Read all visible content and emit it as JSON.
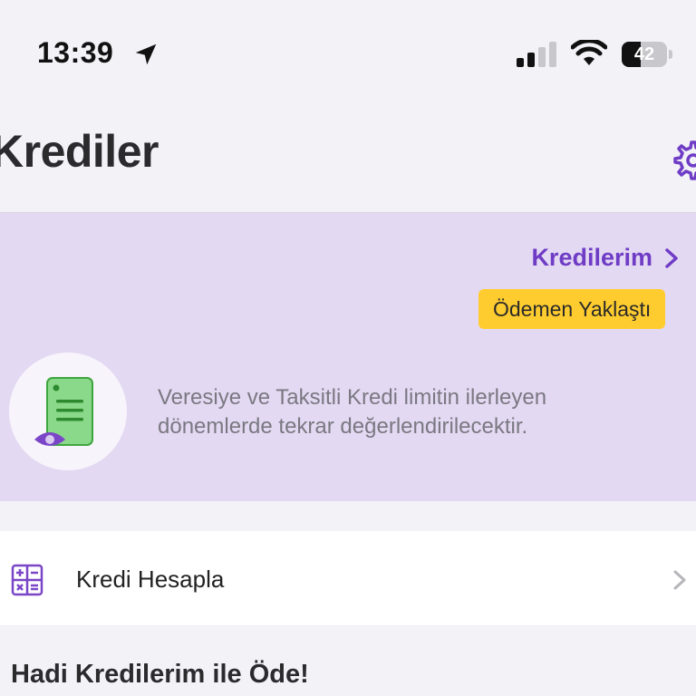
{
  "status_bar": {
    "time": "13:39",
    "battery_level": "42",
    "icons": [
      "location-arrow-icon",
      "cellular-signal-icon",
      "wifi-icon",
      "battery-icon"
    ]
  },
  "header": {
    "title": "Krediler",
    "settings_icon": "gear-icon"
  },
  "promo": {
    "link_label": "Kredilerim",
    "badge_label": "Ödemen Yaklaştı",
    "message": "Veresiye ve Taksitli Kredi limitin ilerleyen dönemlerde tekrar değerlendirilecektir.",
    "illustration_icon": "document-eye-icon"
  },
  "list": {
    "calc_label": "Kredi Hesapla",
    "calc_icon": "calculator-icon"
  },
  "section": {
    "title": "Hadi Kredilerim ile Öde!"
  },
  "colors": {
    "accent": "#6f3cc6",
    "promo_bg": "#e4d9f2",
    "badge_bg": "#ffcc2f"
  }
}
